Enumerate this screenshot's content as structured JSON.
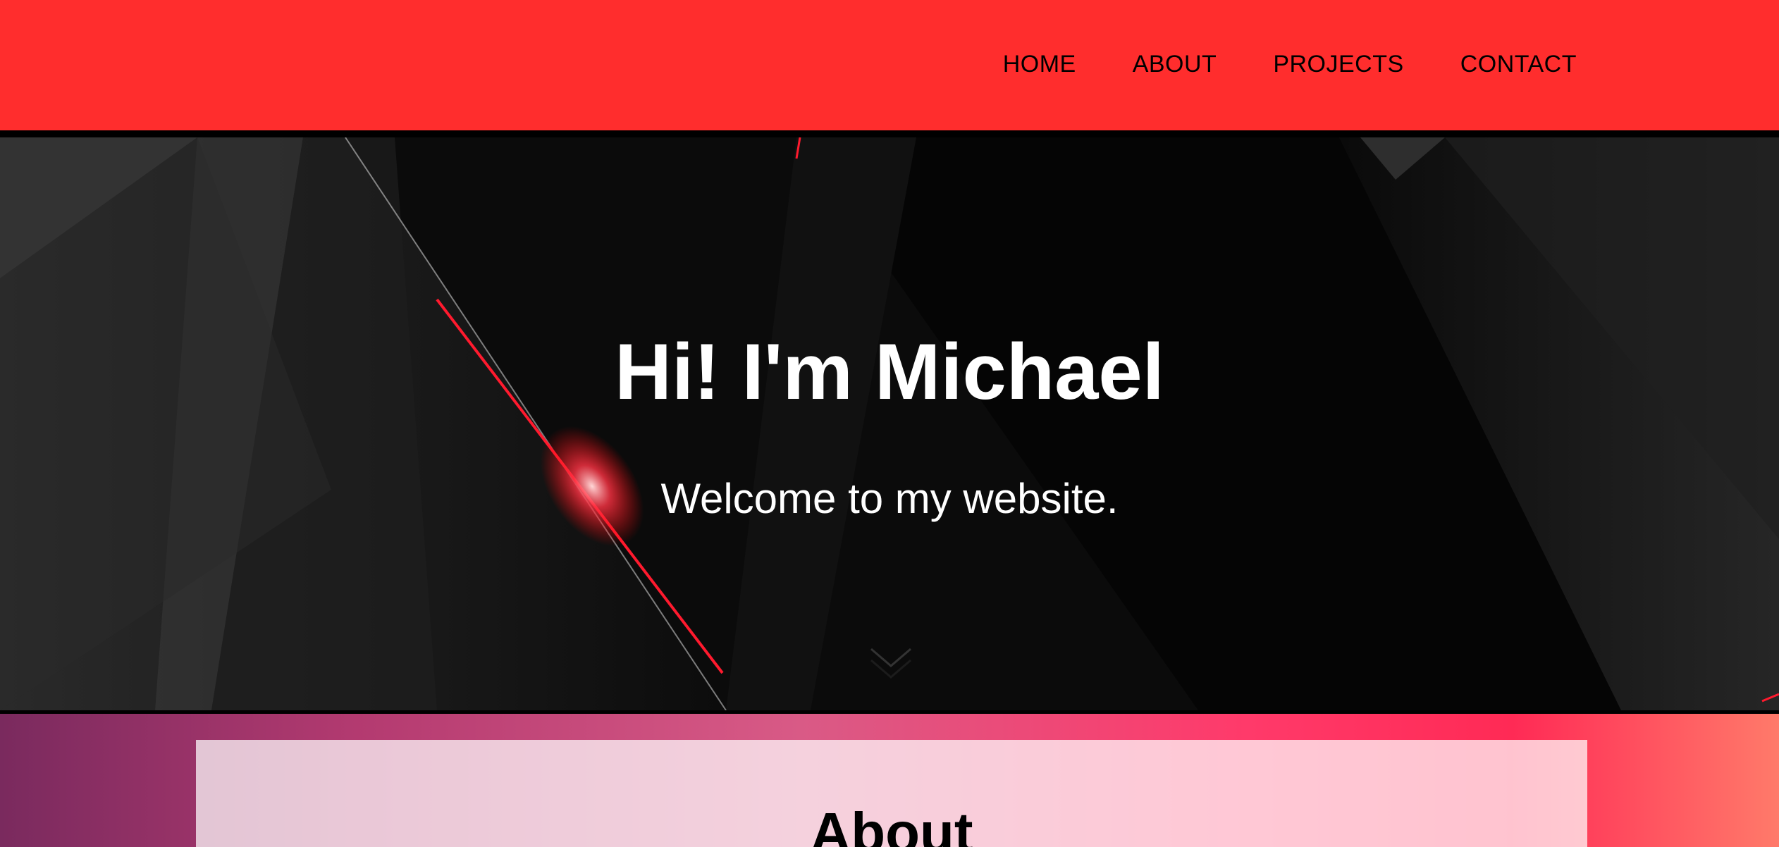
{
  "nav": {
    "items": [
      {
        "label": "HOME"
      },
      {
        "label": "ABOUT"
      },
      {
        "label": "PROJECTS"
      },
      {
        "label": "CONTACT"
      }
    ]
  },
  "hero": {
    "title": "Hi! I'm Michael",
    "subtitle": "Welcome to my website.",
    "scroll_icon": "chevron-down-icon"
  },
  "about": {
    "heading": "About"
  },
  "colors": {
    "nav_background": "#ff2d2d",
    "hero_background": "#0b0b0b",
    "accent_red": "#ff2a3a",
    "text_light": "#ffffff",
    "text_dark": "#000000"
  }
}
